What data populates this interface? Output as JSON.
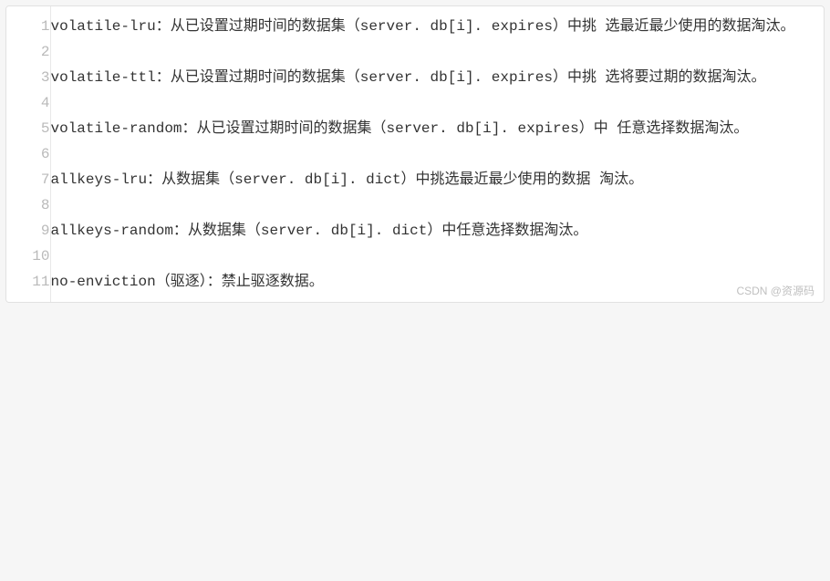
{
  "code": {
    "lines": [
      {
        "num": "1",
        "text": "volatile-lru：从已设置过期时间的数据集（server. db[i]. expires）中挑 选最近最少使用的数据淘汰。"
      },
      {
        "num": "2",
        "text": ""
      },
      {
        "num": "3",
        "text": "volatile-ttl：从已设置过期时间的数据集（server. db[i]. expires）中挑 选将要过期的数据淘汰。"
      },
      {
        "num": "4",
        "text": ""
      },
      {
        "num": "5",
        "text": "volatile-random：从已设置过期时间的数据集（server. db[i]. expires）中 任意选择数据淘汰。"
      },
      {
        "num": "6",
        "text": ""
      },
      {
        "num": "7",
        "text": "allkeys-lru：从数据集（server. db[i]. dict）中挑选最近最少使用的数据 淘汰。"
      },
      {
        "num": "8",
        "text": ""
      },
      {
        "num": "9",
        "text": "allkeys-random：从数据集（server. db[i]. dict）中任意选择数据淘汰。"
      },
      {
        "num": "10",
        "text": ""
      },
      {
        "num": "11",
        "text": "no-enviction（驱逐）：禁止驱逐数据。"
      }
    ]
  },
  "watermark": "CSDN @资源码"
}
